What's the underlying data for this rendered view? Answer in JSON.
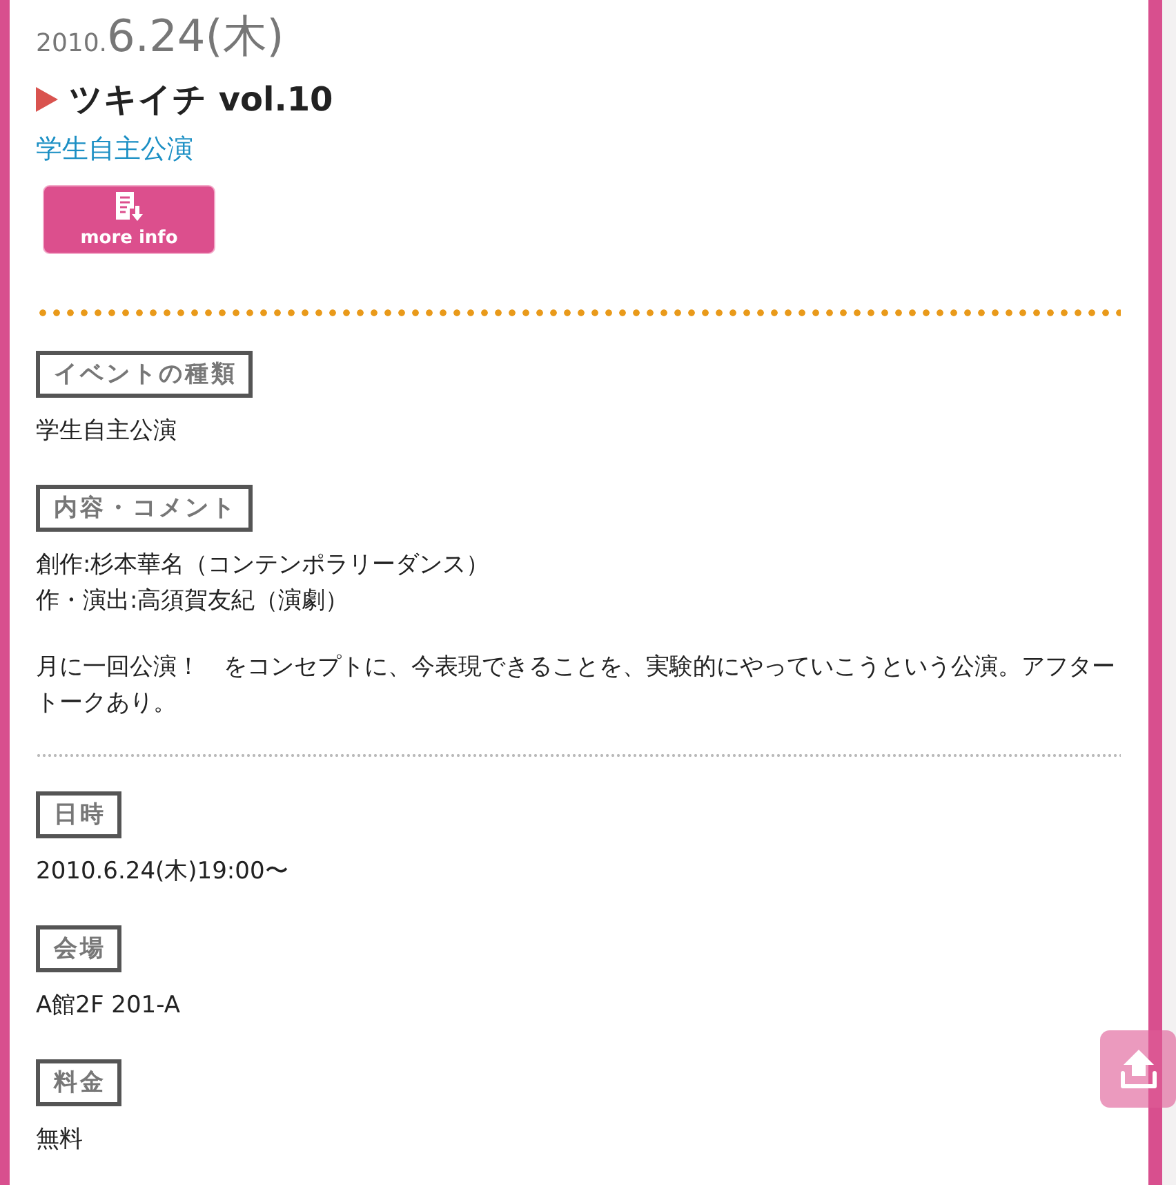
{
  "header": {
    "date_year": "2010.",
    "date_day": "6.24(木)",
    "title": "ツキイチ vol.10",
    "category_link": "学生自主公演",
    "more_button": "more info"
  },
  "section_groups": [
    [
      {
        "heading": "イベントの種類",
        "blocks": [
          [
            "学生自主公演"
          ]
        ]
      },
      {
        "heading": "内容・コメント",
        "blocks": [
          [
            "創作:杉本華名（コンテンポラリーダンス）",
            "作・演出:高須賀友紀（演劇）"
          ],
          [
            "月に一回公演！　をコンセプトに、今表現できることを、実験的にやっていこうという公演。アフタートークあり。"
          ]
        ]
      }
    ],
    [
      {
        "heading": "日時",
        "blocks": [
          [
            "2010.6.24(木)19:00〜"
          ]
        ]
      },
      {
        "heading": "会場",
        "blocks": [
          [
            "A館2F 201-A"
          ]
        ]
      },
      {
        "heading": "料金",
        "blocks": [
          [
            "無料"
          ]
        ]
      }
    ]
  ]
}
